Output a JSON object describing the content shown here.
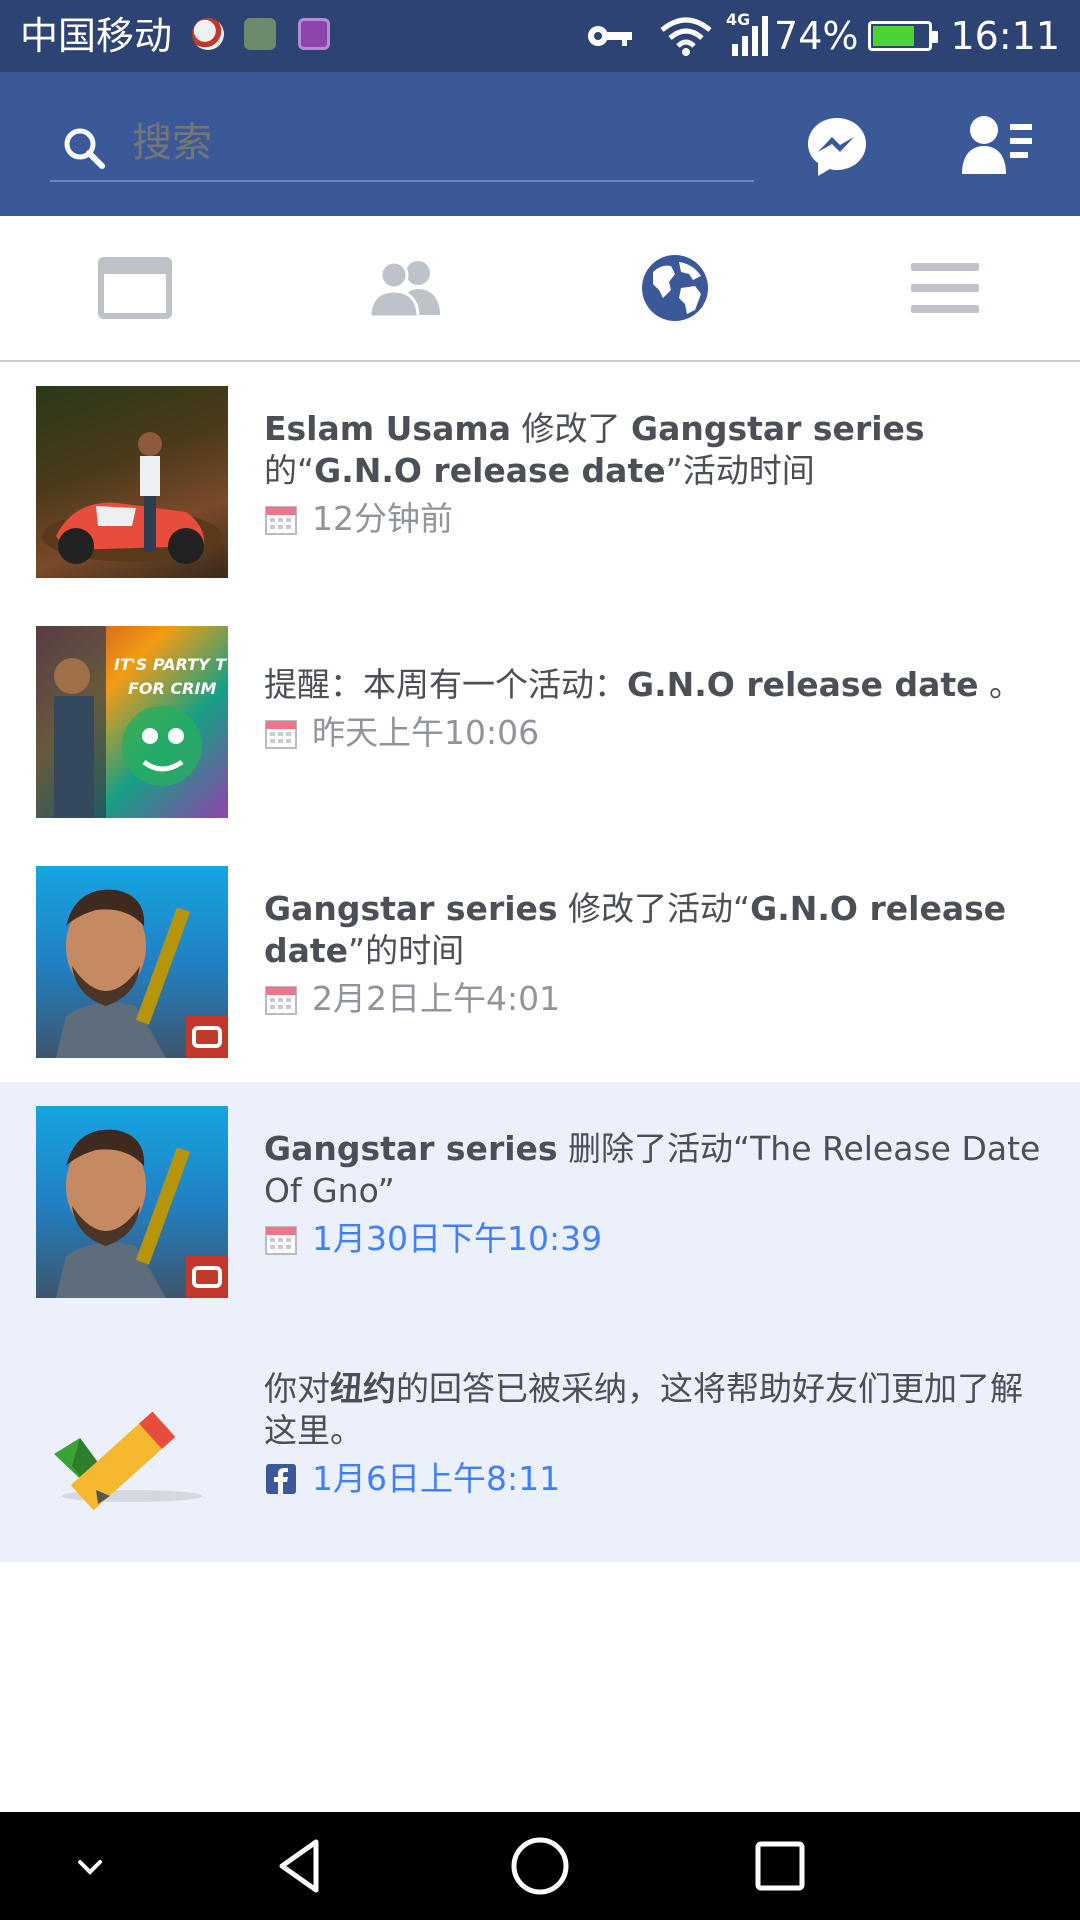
{
  "status_bar": {
    "carrier": "中国移动",
    "network": "4G",
    "battery": "74%",
    "time": "16:11"
  },
  "header": {
    "search_placeholder": "搜索",
    "icons": [
      "search-icon",
      "messenger-icon",
      "friend-requests-icon"
    ]
  },
  "tabs": [
    {
      "name": "news-feed",
      "icon": "news-feed-icon"
    },
    {
      "name": "friends",
      "icon": "friends-icon"
    },
    {
      "name": "notifications",
      "icon": "globe-icon",
      "active": true
    },
    {
      "name": "menu",
      "icon": "menu-icon"
    }
  ],
  "notifications": [
    {
      "parts": [
        {
          "t": "Eslam Usama",
          "b": true
        },
        {
          "t": " 修改了 ",
          "b": false
        },
        {
          "t": "Gangstar series",
          "b": true
        },
        {
          "t": " 的“",
          "b": false
        },
        {
          "t": "G.N.O release date",
          "b": true
        },
        {
          "t": "”活动时间",
          "b": false
        }
      ],
      "time": "12分钟前",
      "icon": "calendar-icon",
      "unread": false,
      "thumb": "motorcycle-photo"
    },
    {
      "parts": [
        {
          "t": "提醒：本周有一个活动：",
          "b": false
        },
        {
          "t": "G.N.O release date",
          "b": true
        },
        {
          "t": " 。",
          "b": false
        }
      ],
      "time": "昨天上午10:06",
      "icon": "calendar-icon",
      "unread": false,
      "thumb": "party-poster"
    },
    {
      "parts": [
        {
          "t": "Gangstar series",
          "b": true
        },
        {
          "t": " 修改了活动“",
          "b": false
        },
        {
          "t": "G.N.O release date",
          "b": true
        },
        {
          "t": "”的时间",
          "b": false
        }
      ],
      "time": "2月2日上午4:01",
      "icon": "calendar-icon",
      "unread": false,
      "thumb": "gangstar-avatar"
    },
    {
      "parts": [
        {
          "t": "Gangstar series",
          "b": true
        },
        {
          "t": " 删除了活动“The Release Date Of Gno”",
          "b": false
        }
      ],
      "time": "1月30日下午10:39",
      "icon": "calendar-icon",
      "unread": true,
      "thumb": "gangstar-avatar"
    },
    {
      "parts": [
        {
          "t": "你对",
          "b": false
        },
        {
          "t": "纽约",
          "b": true
        },
        {
          "t": "的回答已被采纳，这将帮助好友们更加了解这里。",
          "b": false
        }
      ],
      "time": "1月6日上午8:11",
      "icon": "facebook-icon",
      "unread": true,
      "thumb": "checkmark-pencil"
    }
  ],
  "colors": {
    "brand": "#3b5998",
    "status_bar": "#2d4373",
    "unread_bg": "#ecf0fa",
    "link_blue": "#4080ff"
  }
}
